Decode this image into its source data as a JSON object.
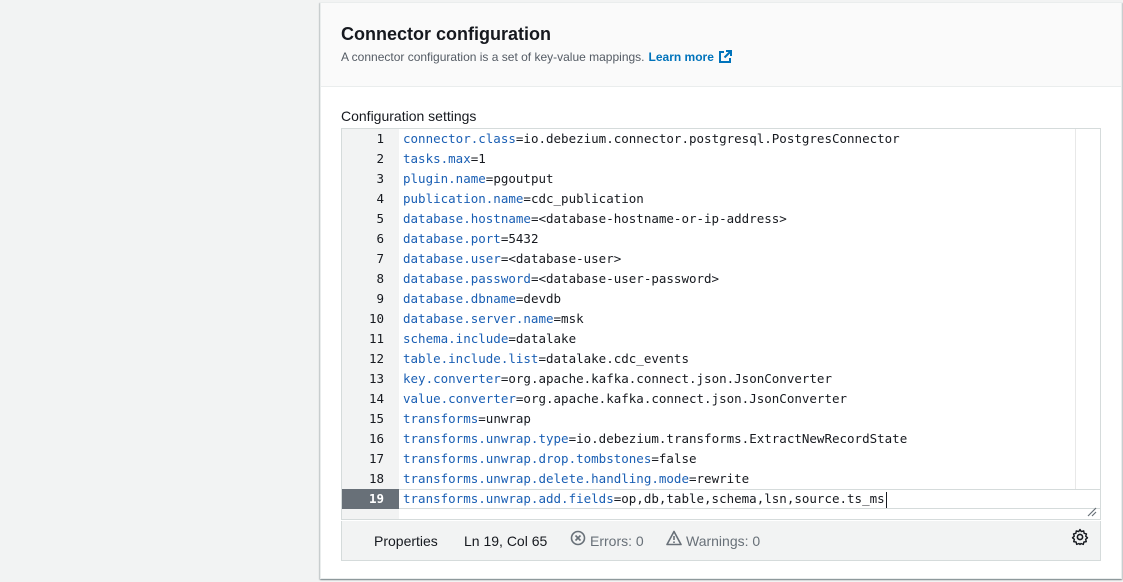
{
  "header": {
    "title": "Connector configuration",
    "description": "A connector configuration is a set of key-value mappings.",
    "learn_more": "Learn more"
  },
  "field": {
    "label": "Configuration settings"
  },
  "editor": {
    "active_line": 19,
    "lines": [
      {
        "num": "1",
        "key": "connector.class",
        "value": "io.debezium.connector.postgresql.PostgresConnector"
      },
      {
        "num": "2",
        "key": "tasks.max",
        "value": "1"
      },
      {
        "num": "3",
        "key": "plugin.name",
        "value": "pgoutput"
      },
      {
        "num": "4",
        "key": "publication.name",
        "value": "cdc_publication"
      },
      {
        "num": "5",
        "key": "database.hostname",
        "value": "<database-hostname-or-ip-address>"
      },
      {
        "num": "6",
        "key": "database.port",
        "value": "5432"
      },
      {
        "num": "7",
        "key": "database.user",
        "value": "<database-user>"
      },
      {
        "num": "8",
        "key": "database.password",
        "value": "<database-user-password>"
      },
      {
        "num": "9",
        "key": "database.dbname",
        "value": "devdb"
      },
      {
        "num": "10",
        "key": "database.server.name",
        "value": "msk"
      },
      {
        "num": "11",
        "key": "schema.include",
        "value": "datalake"
      },
      {
        "num": "12",
        "key": "table.include.list",
        "value": "datalake.cdc_events"
      },
      {
        "num": "13",
        "key": "key.converter",
        "value": "org.apache.kafka.connect.json.JsonConverter"
      },
      {
        "num": "14",
        "key": "value.converter",
        "value": "org.apache.kafka.connect.json.JsonConverter"
      },
      {
        "num": "15",
        "key": "transforms",
        "value": "unwrap"
      },
      {
        "num": "16",
        "key": "transforms.unwrap.type",
        "value": "io.debezium.transforms.ExtractNewRecordState"
      },
      {
        "num": "17",
        "key": "transforms.unwrap.drop.tombstones",
        "value": "false"
      },
      {
        "num": "18",
        "key": "transforms.unwrap.delete.handling.mode",
        "value": "rewrite"
      },
      {
        "num": "19",
        "key": "transforms.unwrap.add.fields",
        "value": "op,db,table,schema,lsn,source.ts_ms"
      }
    ]
  },
  "statusbar": {
    "properties": "Properties",
    "position": "Ln 19, Col 65",
    "errors": "Errors: 0",
    "warnings": "Warnings: 0"
  },
  "colors": {
    "key": "#1a5fb4",
    "link": "#0073bb",
    "active_gutter": "#687078"
  },
  "icons": {
    "external": "external-link-icon",
    "errors": "error-circle-icon",
    "warnings": "warning-triangle-icon",
    "settings": "gear-icon",
    "resize": "resize-handle-icon"
  }
}
